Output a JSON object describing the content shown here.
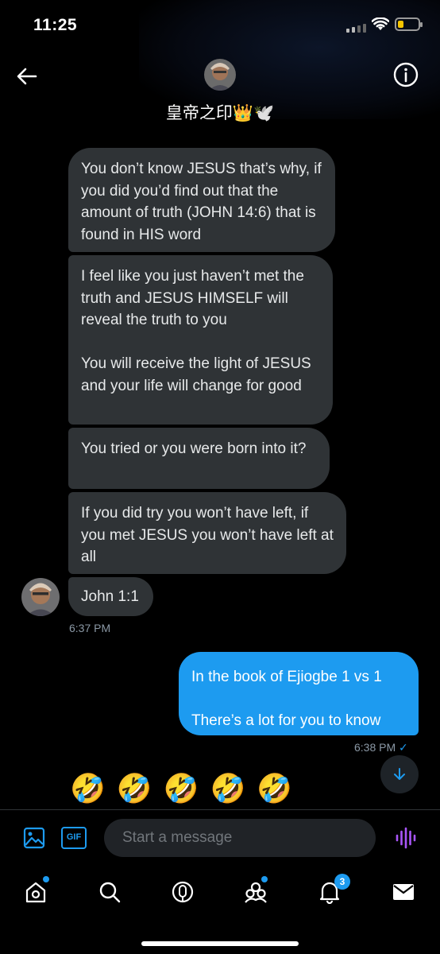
{
  "status_bar": {
    "time": "11:25"
  },
  "header": {
    "title": "皇帝之印👑🕊️"
  },
  "messages": {
    "received": [
      "You don’t know JESUS that’s why, if you did you’d find out that the amount of truth (JOHN 14:6) that is found in HIS word",
      "I feel like you just haven’t met the truth and JESUS HIMSELF will reveal the truth to you\n\nYou will receive the light of JESUS and your life will change for good",
      "You tried or you were born into it?",
      "If you did try you won’t have left, if you met JESUS you won’t have left at all",
      "John 1:1"
    ],
    "received_time": "6:37 PM",
    "sent": [
      "In the book of Ejiogbe 1 vs 1\n\nThere’s a lot for you to know"
    ],
    "sent_time": "6:38 PM",
    "sent_status": "✓",
    "emoji_line": "🤣🤣🤣🤣🤣"
  },
  "composer": {
    "placeholder": "Start a message",
    "gif_label": "GIF"
  },
  "tab_bar": {
    "notifications_badge": "3",
    "items": [
      "home-icon",
      "search-icon",
      "spaces-icon",
      "communities-icon",
      "notifications-icon",
      "messages-icon"
    ]
  },
  "colors": {
    "accent": "#1d9bf0",
    "received_bubble": "#2f3336",
    "voice_accent": "#a855f7",
    "battery": "#f5c400"
  }
}
